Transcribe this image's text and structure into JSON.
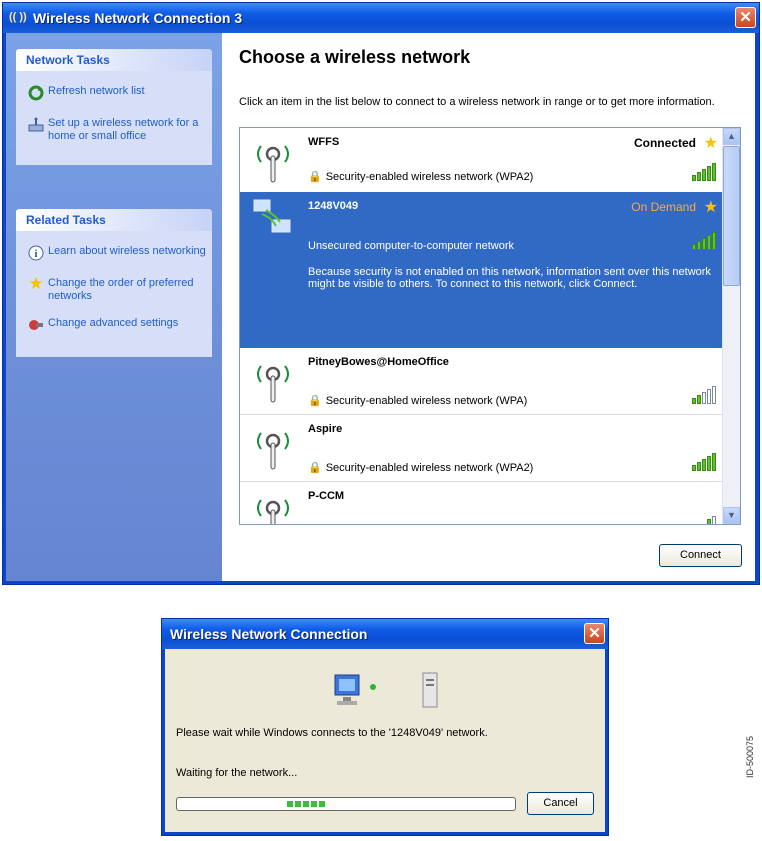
{
  "main_window": {
    "title": "Wireless Network Connection 3",
    "title_icon": "(( ))",
    "close_label": "✕"
  },
  "left_pane": {
    "network_tasks": {
      "header": "Network Tasks",
      "items": [
        {
          "icon": "refresh-icon",
          "label": "Refresh network list"
        },
        {
          "icon": "setup-wireless-icon",
          "label": "Set up a wireless network for a home or small office"
        }
      ]
    },
    "related_tasks": {
      "header": "Related Tasks",
      "items": [
        {
          "icon": "info-icon",
          "label": "Learn about wireless networking"
        },
        {
          "icon": "star-icon",
          "label": "Change the order of preferred networks"
        },
        {
          "icon": "settings-icon",
          "label": "Change advanced settings"
        }
      ]
    }
  },
  "main": {
    "heading": "Choose a wireless network",
    "instructions": "Click an item in the list below to connect to a wireless network in range or to get more information.",
    "connect_label": "Connect",
    "networks": [
      {
        "name": "WFFS",
        "status": "Connected",
        "security": "Security-enabled wireless network (WPA2)",
        "signal_bars": 5,
        "selected": false
      },
      {
        "name": "1248V049",
        "status": "On Demand",
        "security": "Unsecured computer-to-computer network",
        "description": "Because security is not enabled on this network, information sent over this network might be visible to others. To connect to this network, click Connect.",
        "signal_bars": 5,
        "selected": true
      },
      {
        "name": "PitneyBowes@HomeOffice",
        "status": "",
        "security": "Security-enabled wireless network (WPA)",
        "signal_bars": 2,
        "selected": false
      },
      {
        "name": "Aspire",
        "status": "",
        "security": "Security-enabled wireless network (WPA2)",
        "signal_bars": 5,
        "selected": false
      },
      {
        "name": "P-CCM",
        "status": "",
        "security": "",
        "signal_bars": 1,
        "selected": false
      }
    ]
  },
  "dialog": {
    "title": "Wireless Network Connection",
    "close_label": "✕",
    "message": "Please wait while Windows connects to the '1248V049' network.",
    "waiting": "Waiting for the network...",
    "cancel_label": "Cancel"
  },
  "figure_id": "ID-500075"
}
